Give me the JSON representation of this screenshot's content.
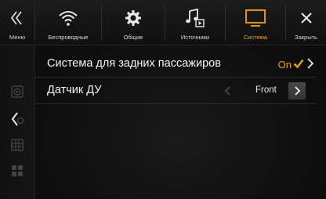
{
  "topbar": {
    "menu_label": "Меню",
    "wireless_label": "Беспроводные",
    "general_label": "Общие",
    "sources_label": "Источники",
    "system_label": "Система",
    "close_label": "Закрыть",
    "active_color": "#f2a400"
  },
  "settings": {
    "rear_system_label": "Система для задних пассажиров",
    "rear_system_value": "On",
    "remote_sensor_label": "Датчик ДУ",
    "remote_sensor_value": "Front"
  },
  "icons": {
    "menu": "double-chevron-left-icon",
    "wireless": "wifi-icon",
    "general": "gear-icon",
    "sources": "music-note-icon",
    "system": "monitor-icon",
    "close": "close-icon",
    "rail": [
      "speaker-icon",
      "chevron-left-icon",
      "grid-icon",
      "apps-icon"
    ]
  }
}
